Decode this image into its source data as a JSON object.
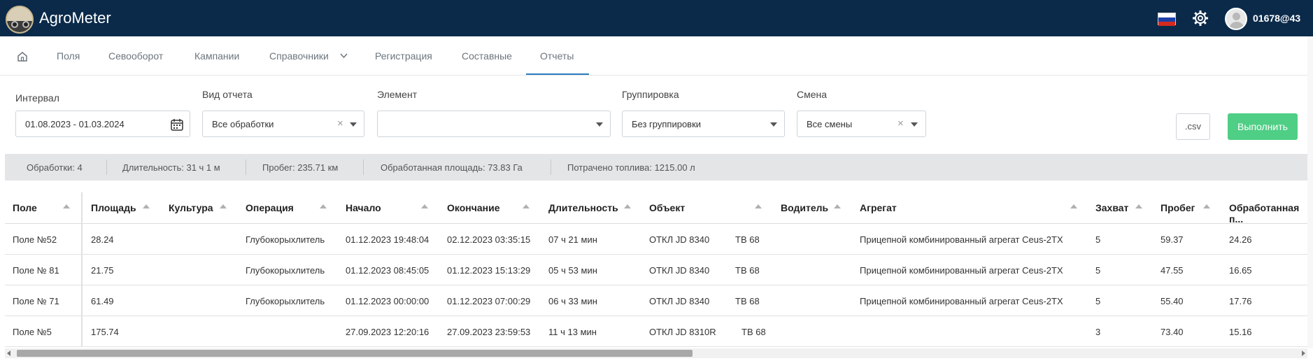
{
  "header": {
    "app_title": "AgroMeter",
    "user": "01678@43",
    "icons": [
      "logo-icon",
      "russia-flag-icon",
      "gear-icon",
      "avatar-icon"
    ],
    "colors": {
      "bar": "#0b2a4a",
      "accent": "#2b7bc0",
      "run_button": "#4fce85"
    }
  },
  "nav": {
    "items": [
      "Поля",
      "Севооборот",
      "Кампании",
      "Справочники",
      "Регистрация",
      "Составные",
      "Отчеты"
    ],
    "active": "Отчеты"
  },
  "filters": {
    "interval_label": "Интервал",
    "interval_value": "01.08.2023 - 01.03.2024",
    "report_type_label": "Вид отчета",
    "report_type_value": "Все обработки",
    "element_label": "Элемент",
    "element_value": "",
    "grouping_label": "Группировка",
    "grouping_value": "Без группировки",
    "shift_label": "Смена",
    "shift_value": "Все смены",
    "csv_button": ".csv",
    "run_button": "Выполнить"
  },
  "summary": {
    "treatments": "Обработки: 4",
    "duration": "Длительность: 31 ч 1 м",
    "mileage": "Пробег: 235.71 км",
    "area": "Обработанная площадь: 73.83 Га",
    "fuel": "Потрачено топлива: 1215.00 л"
  },
  "table": {
    "columns": [
      "Поле",
      "Площадь",
      "Культура",
      "Операция",
      "Начало",
      "Окончание",
      "Длительность",
      "Объект",
      "Водитель",
      "Агрегат",
      "Захват",
      "Пробег",
      "Обработанная п..."
    ],
    "rows": [
      {
        "field": "Поле №52",
        "area": "28.24",
        "culture": "",
        "operation": "Глубокорыхлитель",
        "start": "01.12.2023 19:48:04",
        "end": "02.12.2023 03:35:15",
        "duration": "07 ч 21 мин",
        "object": "ОТКЛ JD 8340",
        "object2": "ТВ 68",
        "driver": "",
        "aggregate": "Прицепной комбинированный агрегат Ceus-2TX",
        "width": "5",
        "mileage": "59.37",
        "processed": "24.26"
      },
      {
        "field": "Поле № 81",
        "area": "21.75",
        "culture": "",
        "operation": "Глубокорыхлитель",
        "start": "01.12.2023 08:45:05",
        "end": "01.12.2023 15:13:29",
        "duration": "05 ч 53 мин",
        "object": "ОТКЛ JD 8340",
        "object2": "ТВ 68",
        "driver": "",
        "aggregate": "Прицепной комбинированный агрегат Ceus-2TX",
        "width": "5",
        "mileage": "47.55",
        "processed": "16.65"
      },
      {
        "field": "Поле № 71",
        "area": "61.49",
        "culture": "",
        "operation": "Глубокорыхлитель",
        "start": "01.12.2023 00:00:00",
        "end": "01.12.2023 07:00:29",
        "duration": "06 ч 33 мин",
        "object": "ОТКЛ JD 8340",
        "object2": "ТВ 68",
        "driver": "",
        "aggregate": "Прицепной комбинированный агрегат Ceus-2TX",
        "width": "5",
        "mileage": "55.40",
        "processed": "17.76"
      },
      {
        "field": "Поле №5",
        "area": "175.74",
        "culture": "",
        "operation": "",
        "start": "27.09.2023 12:20:16",
        "end": "27.09.2023 23:59:53",
        "duration": "11 ч 13 мин",
        "object": "ОТКЛ JD 8310R",
        "object2": "ТВ 68",
        "driver": "",
        "aggregate": "",
        "width": "3",
        "mileage": "73.40",
        "processed": "15.16"
      }
    ]
  }
}
